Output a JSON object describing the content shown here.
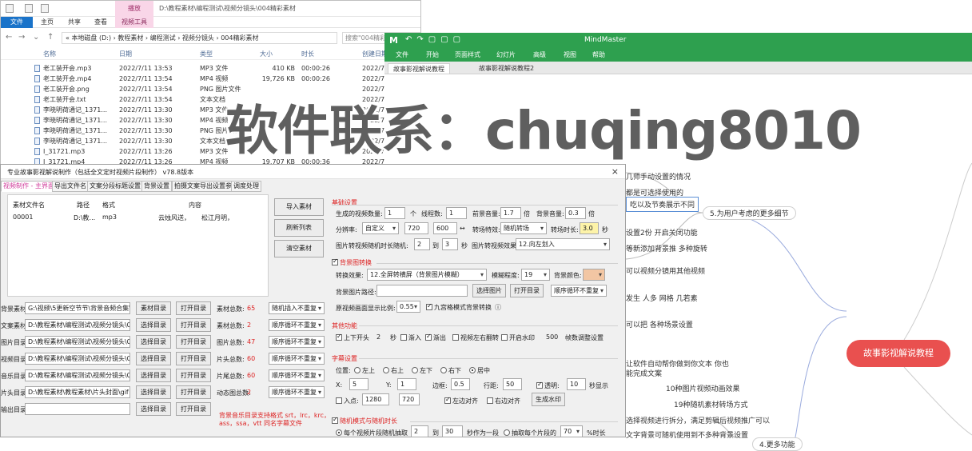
{
  "explorer": {
    "context_tab": "播放",
    "title_path": "D:\\教程素材\\编程测试\\视频分镜头\\004精彩素材",
    "ribbon": {
      "file": "文件",
      "home": "主页",
      "share": "共享",
      "view": "查看",
      "video_tools": "视频工具"
    },
    "address": "« 本地磁盘 (D:) › 教程素材 › 编程测试 › 视频分镜头 › 004精彩素材",
    "search_placeholder": "搜索\"004精彩素材\"",
    "columns": {
      "name": "名称",
      "date": "日期",
      "type": "类型",
      "size": "大小",
      "duration": "时长",
      "created": "创建日期"
    },
    "files": [
      {
        "name": "老工装开会.mp3",
        "date": "2022/7/11 13:53",
        "type": "MP3 文件",
        "size": "410 KB",
        "duration": "00:00:26",
        "created": "2022/7/11"
      },
      {
        "name": "老工装开会.mp4",
        "date": "2022/7/11 13:54",
        "type": "MP4 视频",
        "size": "19,726 KB",
        "duration": "00:00:26",
        "created": "2022/7/11"
      },
      {
        "name": "老工装开会.png",
        "date": "2022/7/11 13:54",
        "type": "PNG 图片文件",
        "size": "",
        "duration": "",
        "created": "2022/7/11"
      },
      {
        "name": "老工装开会.txt",
        "date": "2022/7/11 13:54",
        "type": "文本文档",
        "size": "",
        "duration": "",
        "created": "2022/7/11"
      },
      {
        "name": "李晓明荷通记_1371...",
        "date": "2022/7/11 13:30",
        "type": "MP3 文件",
        "size": "",
        "duration": "",
        "created": "2022/7/11"
      },
      {
        "name": "李晓明荷通记_1371...",
        "date": "2022/7/11 13:30",
        "type": "MP4 视频",
        "size": "",
        "duration": "",
        "created": "2022/7/11"
      },
      {
        "name": "李晓明荷通记_1371...",
        "date": "2022/7/11 13:30",
        "type": "PNG 图片文件",
        "size": "",
        "duration": "",
        "created": "2022/7/11"
      },
      {
        "name": "李晓明荷通记_1371...",
        "date": "2022/7/11 13:30",
        "type": "文本文档",
        "size": "",
        "duration": "",
        "created": "2022/7/11"
      },
      {
        "name": "I_31721.mp3",
        "date": "2022/7/11 13:26",
        "type": "MP3 文件",
        "size": "",
        "duration": "",
        "created": "2022/7/11"
      },
      {
        "name": "I_31721.mp4",
        "date": "2022/7/11 13:26",
        "type": "MP4 视频",
        "size": "19,707 KB",
        "duration": "00:00:36",
        "created": "2022/7/11"
      }
    ]
  },
  "mindmaster": {
    "logo": "M",
    "app_title": "MindMaster",
    "menu": [
      "文件",
      "开始",
      "页面样式",
      "幻灯片",
      "高级",
      "视图",
      "帮助"
    ],
    "tabs": [
      "故事影视解说教程",
      "故事影视解说教程2"
    ],
    "central_topic": "故事影视解说教程",
    "topics": {
      "t5": "5.为用户考虑的更多细节",
      "t4": "4.更多功能"
    },
    "partial_nodes": [
      "几师手动设置的情况",
      "都是可选择使用的",
      "吃以及节奏展示不同",
      "设置2份 开启关闭功能",
      "等新添加背景推 多种旋转",
      "可以视频分镜用其他视频",
      "发生 人多 网格 几若素",
      "可以把 各种场景设置",
      "让软件自动帮你做到你文本 你也",
      "能完成文案",
      "10种图片视频动画效果",
      "19种随机素材转场方式",
      "选择视频进行拆分，满足剪辑后视频推广可以",
      "文字背景可随机使用到不多种背景设置"
    ]
  },
  "tool": {
    "title": "专业故事影视解说制作（包括全文定时视频片段制作） v78.8版本",
    "close": "×",
    "tabs": [
      "视频制作 - 主界面",
      "导出文件名",
      "文案分段标题设置",
      "背景设置",
      "拍摄文案导出设置参数",
      "调度处理"
    ],
    "list_headers": [
      "素材文件名",
      "路径",
      "格式",
      "内容"
    ],
    "list_rows": [
      [
        "00001",
        "D:\\教...",
        "mp3",
        "云烛风送，",
        "松江月明，"
      ]
    ],
    "side_buttons": [
      "导入素材",
      "刷新列表",
      "清空素材"
    ],
    "left_rows": [
      {
        "label": "背景素材:",
        "path": "G:\\视频\\5更新空节节\\背景音频合集\\",
        "b1": "素材目录",
        "b2": "打开目录",
        "count_label": "素材总数:",
        "count": "65",
        "mode": "随机插入不重复"
      },
      {
        "label": "文案素材:",
        "path": "D:\\教程素材\\编程测试\\视频分镜头\\00",
        "b1": "选择目录",
        "b2": "打开目录",
        "count_label": "素材总数:",
        "count": "2",
        "mode": "顺序循环不重复"
      },
      {
        "label": "图片目录:",
        "path": "D:\\教程素材\\编程测试\\视频分镜头\\00",
        "b1": "选择目录",
        "b2": "打开目录",
        "count_label": "图片总数:",
        "count": "47",
        "mode": "顺序循环不重复"
      },
      {
        "label": "视频目录:",
        "path": "D:\\教程素材\\编程测试\\视频分镜头\\00",
        "b1": "选择目录",
        "b2": "打开目录",
        "count_label": "片头总数:",
        "count": "60",
        "mode": "顺序循环不重复"
      },
      {
        "label": "音乐目录:",
        "path": "D:\\教程素材\\编程测试\\视频分镜头\\00",
        "b1": "选择目录",
        "b2": "打开目录",
        "count_label": "片尾总数:",
        "count": "60",
        "mode": "顺序循环不重复"
      },
      {
        "label": "片头目录:",
        "path": "D:\\教程素材\\教程素材\\片头封面\\gif",
        "b1": "选择目录",
        "b2": "打开目录",
        "count_label": "动态图总数:",
        "count": "2",
        "mode": "顺序循环不重复"
      },
      {
        "label": "输出目录:",
        "path": "",
        "b1": "选择目录",
        "b2": "打开目录",
        "count_label": "",
        "count": "",
        "mode": ""
      }
    ],
    "footnote1": "背景音乐目录支持格式 srt，lrc，krc，",
    "footnote2": "ass，ssa，vtt 同名字幕文件",
    "right": {
      "base_title": "基础设置",
      "gen_count_label": "生成的视频数量:",
      "gen_count": "1",
      "gen_unit": "个",
      "thread_label": "线程数:",
      "thread": "1",
      "speed_label": "前景音量:",
      "speed": "1.7",
      "times1": "倍",
      "bg_label": "背景音量:",
      "bg": "0.3",
      "times2": "倍",
      "res_label": "分辨率:",
      "res_mode": "自定义",
      "w": "720",
      "h": "600",
      "arrow": "↔",
      "voice_label": "转场特效:",
      "voice": "随机转场",
      "fade_label": "转场时长:",
      "fade": "3.0",
      "sec": "秒",
      "pic_label": "图片转视频随机时长随机:",
      "pic_a": "2",
      "to": "到",
      "pic_b": "3",
      "pic_unit": "秒",
      "effect_label": "图片转视频效果:",
      "effect": "12.向左划入",
      "bg_section": "背景图转换",
      "switch_label": "转换效果:",
      "switch_val": "12.全屏转横屏（背景图片模糊）",
      "blur_label": "模糊程度:",
      "blur": "19",
      "color_label": "背景颜色:",
      "color_hex": "#f2c6a3",
      "bgpath_label": "背景图片路径:",
      "bgpath": "",
      "pick": "选择图片",
      "open": "打开目录",
      "order": "顺序循环不重复",
      "scale_label": "原视频画面显示比例:",
      "scale": "0.55",
      "keep_label": "九宫格模式背景转换",
      "other_title": "其他功能",
      "opt_a": "上下开头",
      "opt_a_val": "2",
      "opt_a_unit": "秒",
      "opt_b": "渐入",
      "opt_c": "渐出",
      "opt_d": "视频左右翻转",
      "opt_e": "开启水印",
      "opt_f_val": "500",
      "opt_f": "帧数调整设置",
      "sub_title": "字幕设置",
      "pos_label": "位置:",
      "p1": "左上",
      "p2": "右上",
      "p3": "左下",
      "p4": "右下",
      "p5": "居中",
      "size_label": "字号:",
      "x_label": "X:",
      "x": "5",
      "y_label": "Y:",
      "y": "1",
      "fsize_label": "边框:",
      "fsize": "0.5",
      "spacing_label": "行距:",
      "spacing": "50",
      "alpha_label": "透明:",
      "alpha": "10",
      "alpha_unit": "秒显示",
      "in_label": "入点:",
      "in_w": "1280",
      "in_h": "720",
      "cb_left": "左边对齐",
      "cb_right": "右边对齐",
      "gen_btn": "生成水印",
      "rand_title": "随机模式与随机时长",
      "r1": "每个视频片段随机抽取",
      "r1a": "2",
      "to2": "到",
      "r1b": "30",
      "r1unit": "秒作为一段",
      "r2": "抽取每个片段的",
      "r2val": "70",
      "r2unit": "%时长"
    }
  },
  "watermark": "软件联系：chuqing8010"
}
